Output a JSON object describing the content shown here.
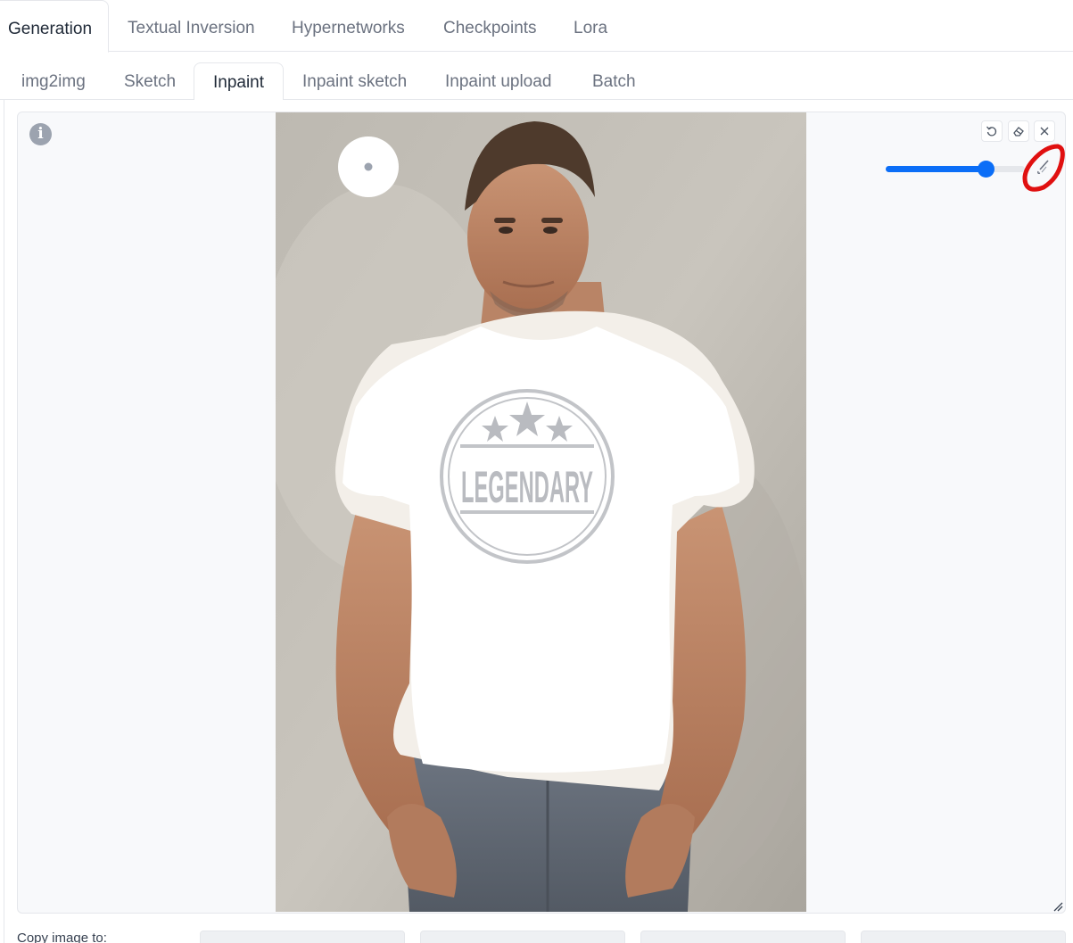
{
  "tabs_top": [
    {
      "label": "Generation",
      "active": true
    },
    {
      "label": "Textual Inversion"
    },
    {
      "label": "Hypernetworks"
    },
    {
      "label": "Checkpoints"
    },
    {
      "label": "Lora"
    }
  ],
  "tabs_sub": [
    {
      "label": "img2img"
    },
    {
      "label": "Sketch"
    },
    {
      "label": "Inpaint",
      "active": true
    },
    {
      "label": "Inpaint sketch"
    },
    {
      "label": "Inpaint upload"
    },
    {
      "label": "Batch"
    }
  ],
  "editor": {
    "info_glyph": "i",
    "toolbar": {
      "undo_icon": "undo-icon",
      "clear_icon": "eraser-icon",
      "close_icon": "close-icon",
      "brush_size_fraction": 0.72,
      "slider_color": "#0b6ef7",
      "brush_color_icon": "brush-color-icon",
      "highlight_color": "#e01010"
    },
    "image": {
      "shirt_text": "LEGENDARY",
      "mask_color": "#ffffff"
    }
  },
  "copy": {
    "label": "Copy image to:"
  }
}
